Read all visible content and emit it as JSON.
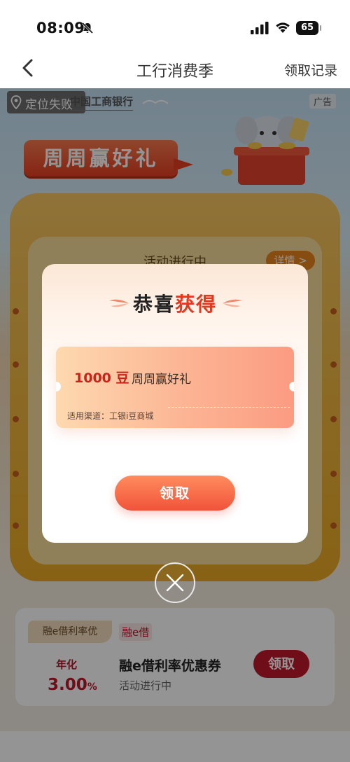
{
  "status_bar": {
    "time": "08:09",
    "battery": "65",
    "icons": [
      "bell-muted-icon",
      "signal-icon",
      "wifi-icon",
      "battery-icon"
    ]
  },
  "nav": {
    "title": "工行消费季",
    "record": "领取记录",
    "back_icon": "chevron-left-icon"
  },
  "page": {
    "location_chip": "定位失败",
    "bank_name": "中国工商银行",
    "ad_label": "广告",
    "banner_title": "周周赢好礼"
  },
  "activity": {
    "status": "活动进行中",
    "details_label": "详情 >"
  },
  "loan_card": {
    "tag_left": "融e借利率优",
    "tag_right": "融e借",
    "rate_label": "年化",
    "rate_value": "3.00",
    "rate_unit": "%",
    "title": "融e借利率优惠券",
    "subtitle": "活动进行中",
    "button": "领取"
  },
  "modal": {
    "title_prefix": "恭喜",
    "title_highlight": "获得",
    "coupon": {
      "amount": "1000 豆",
      "name": "周周赢好礼",
      "channel": "适用渠道：工银i豆商城"
    },
    "button": "领取"
  },
  "colors": {
    "accent_red": "#c0182a",
    "coupon_text_red": "#c8251a",
    "modal_button": "#f0533a",
    "banner": "#e63f22",
    "activity_card": "#f0b43c"
  }
}
